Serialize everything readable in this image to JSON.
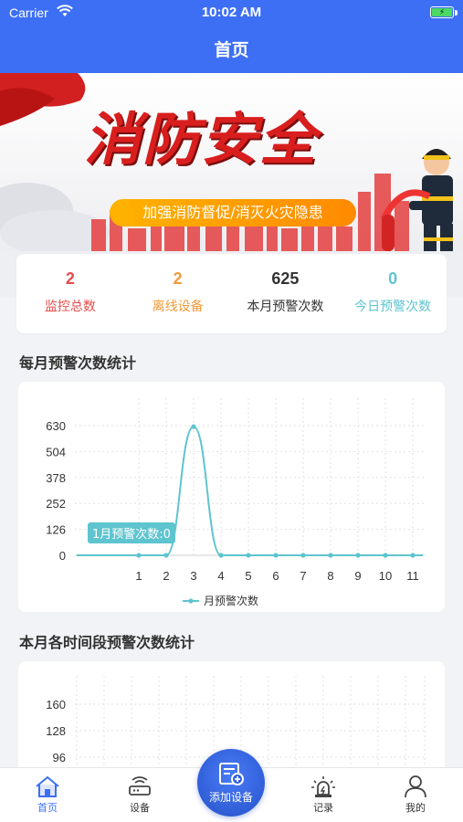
{
  "status_bar": {
    "carrier": "Carrier",
    "time": "10:02 AM"
  },
  "nav": {
    "title": "首页"
  },
  "banner": {
    "title": "消防安全",
    "slogan": "加强消防督促/消灭火灾隐患"
  },
  "stats": [
    {
      "value": "2",
      "label": "监控总数",
      "color": "#e84b4b"
    },
    {
      "value": "2",
      "label": "离线设备",
      "color": "#f29a38"
    },
    {
      "value": "625",
      "label": "本月预警次数",
      "color": "#333333"
    },
    {
      "value": "0",
      "label": "今日预警次数",
      "color": "#5ec4cf"
    }
  ],
  "sections": {
    "monthly_title": "每月预警次数统计",
    "period_title": "本月各时间段预警次数统计"
  },
  "chart_data": [
    {
      "type": "line",
      "title": "每月预警次数统计",
      "x": [
        "1",
        "2",
        "3",
        "4",
        "5",
        "6",
        "7",
        "8",
        "9",
        "10",
        "11"
      ],
      "series": [
        {
          "name": "月预警次数",
          "values": [
            0,
            0,
            625,
            0,
            0,
            0,
            0,
            0,
            0,
            0,
            0
          ]
        }
      ],
      "yticks": [
        0,
        126,
        252,
        378,
        504,
        630
      ],
      "ylim": [
        0,
        630
      ],
      "tooltip": "1月预警次数:0",
      "legend": "bottom-center",
      "grid": true,
      "color": "#5ec4cf"
    },
    {
      "type": "line",
      "title": "本月各时间段预警次数统计",
      "yticks_visible": [
        96,
        128,
        160
      ],
      "grid": true
    }
  ],
  "tabbar": {
    "items": [
      {
        "label": "首页",
        "icon": "home-icon"
      },
      {
        "label": "设备",
        "icon": "router-icon"
      },
      {
        "label": "添加设备",
        "icon": "add-device-icon"
      },
      {
        "label": "记录",
        "icon": "alarm-light-icon"
      },
      {
        "label": "我的",
        "icon": "user-icon"
      }
    ],
    "active_color": "#3d6ff5"
  },
  "colors": {
    "brand": "#3d6ff5",
    "line": "#5ec4cf"
  }
}
